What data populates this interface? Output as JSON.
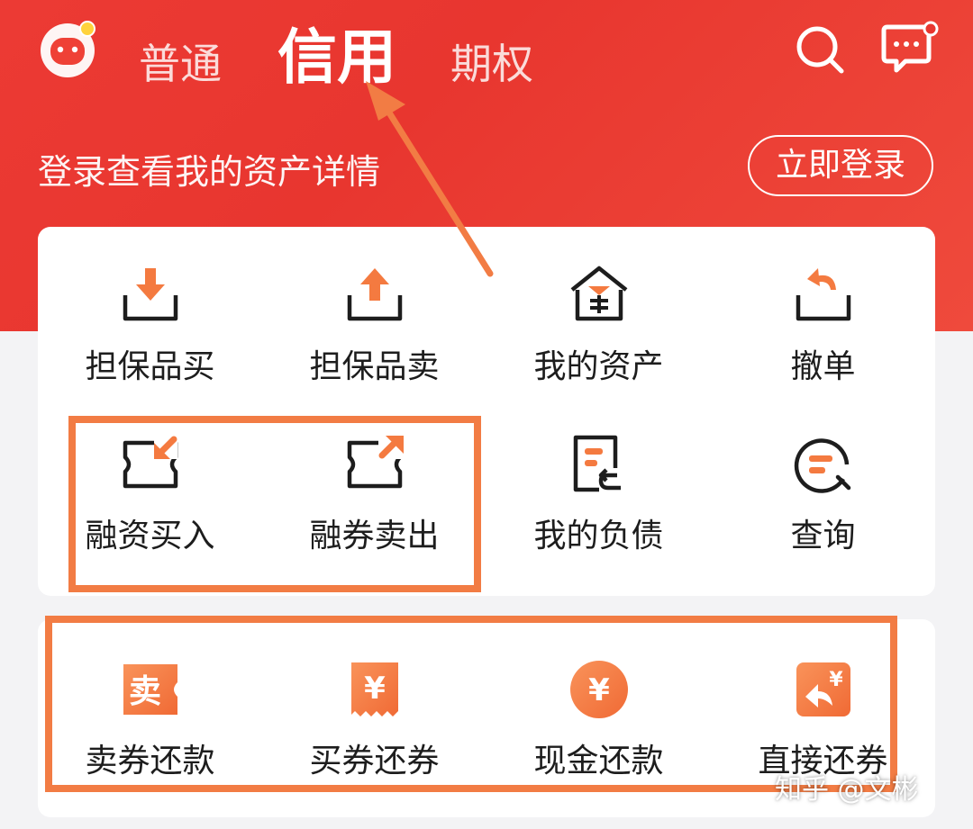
{
  "header": {
    "tabs": [
      {
        "label": "普通"
      },
      {
        "label": "信用",
        "active": true
      },
      {
        "label": "期权"
      }
    ],
    "login_prompt": "登录查看我的资产详情",
    "login_button": "立即登录"
  },
  "grid": {
    "row1": [
      {
        "label": "担保品买",
        "icon": "download-tray-icon"
      },
      {
        "label": "担保品卖",
        "icon": "upload-tray-icon"
      },
      {
        "label": "我的资产",
        "icon": "house-yen-icon"
      },
      {
        "label": "撤单",
        "icon": "undo-tray-icon"
      }
    ],
    "row2": [
      {
        "label": "融资买入",
        "icon": "ticket-arrow-in-icon"
      },
      {
        "label": "融券卖出",
        "icon": "ticket-arrow-out-icon"
      },
      {
        "label": "我的负债",
        "icon": "document-return-icon"
      },
      {
        "label": "查询",
        "icon": "chat-search-icon"
      }
    ]
  },
  "repay": {
    "items": [
      {
        "label": "卖券还款",
        "icon": "sell-ticket-icon",
        "glyph": "卖"
      },
      {
        "label": "买券还券",
        "icon": "yen-receipt-icon",
        "glyph": "¥"
      },
      {
        "label": "现金还款",
        "icon": "yen-coin-icon",
        "glyph": "¥"
      },
      {
        "label": "直接还券",
        "icon": "yen-return-icon",
        "glyph": "¥"
      }
    ]
  },
  "watermark": "知乎 @文彬",
  "colors": {
    "header_red": "#e8362f",
    "icon_orange": "#f47a40",
    "highlight_orange": "#f27c44",
    "text_dark": "#1d1d1d"
  }
}
